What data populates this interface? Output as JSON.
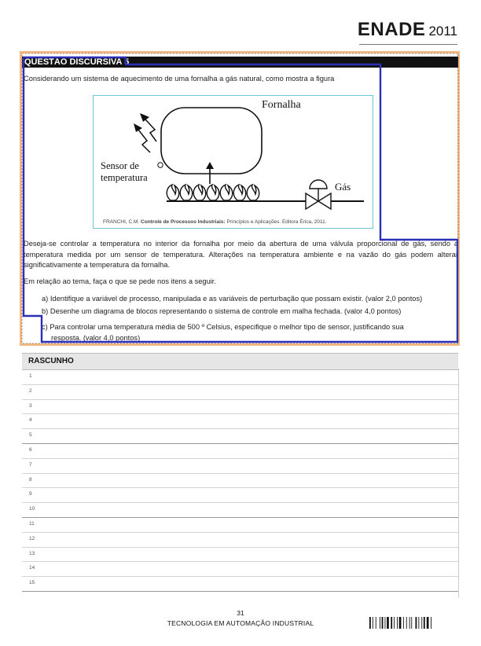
{
  "header": {
    "logo_text": "ENADE",
    "logo_year": "2011"
  },
  "question": {
    "title": "QUESTÃO DISCURSIVA 5",
    "intro": "Considerando um sistema de aquecimento de uma fornalha a gás natural, como mostra a figura",
    "figure": {
      "label_furnace": "Fornalha",
      "label_sensor_line1": "Sensor de",
      "label_sensor_line2": "temperatura",
      "label_gas": "Gás",
      "caption_author": "FRANCHI, C.M.",
      "caption_title": "Controle de Processos Industriais:",
      "caption_rest": "Princípios e Aplicações. Editora Érica, 2011."
    },
    "paragraph": "Deseja-se controlar a temperatura no interior da fornalha por meio da abertura de uma válvula proporcional de gás, sendo a temperatura medida por um sensor de temperatura. Alterações na temperatura ambiente e na vazão do gás podem alterar significativamente a temperatura da fornalha.",
    "instruction": "Em relação ao tema, faça o que se pede nos itens a seguir.",
    "items": [
      {
        "text": "a) Identifique a variável de processo, manipulada e as variáveis de perturbação que possam existir. (valor 2,0 pontos)"
      },
      {
        "text": "b) Desenhe um diagrama de blocos representando o sistema de controle em malha fechada. (valor 4,0 pontos)"
      },
      {
        "text": "c) Para controlar uma temperatura média de 500 º Celsius, especifique o melhor tipo de sensor, justificando sua",
        "continuation": "resposta. (valor 4,0 pontos)"
      }
    ]
  },
  "draft": {
    "title": "RASCUNHO",
    "lines": [
      "1",
      "2",
      "3",
      "4",
      "5",
      "6",
      "7",
      "8",
      "9",
      "10",
      "11",
      "12",
      "13",
      "14",
      "15"
    ]
  },
  "footer": {
    "page_number": "31",
    "course": "TECNOLOGIA EM AUTOMAÇÃO INDUSTRIAL"
  },
  "colors": {
    "frame_orange": "#f4b983",
    "annotation_blue": "#2b2fb8",
    "figure_border": "#6cc8d8"
  }
}
